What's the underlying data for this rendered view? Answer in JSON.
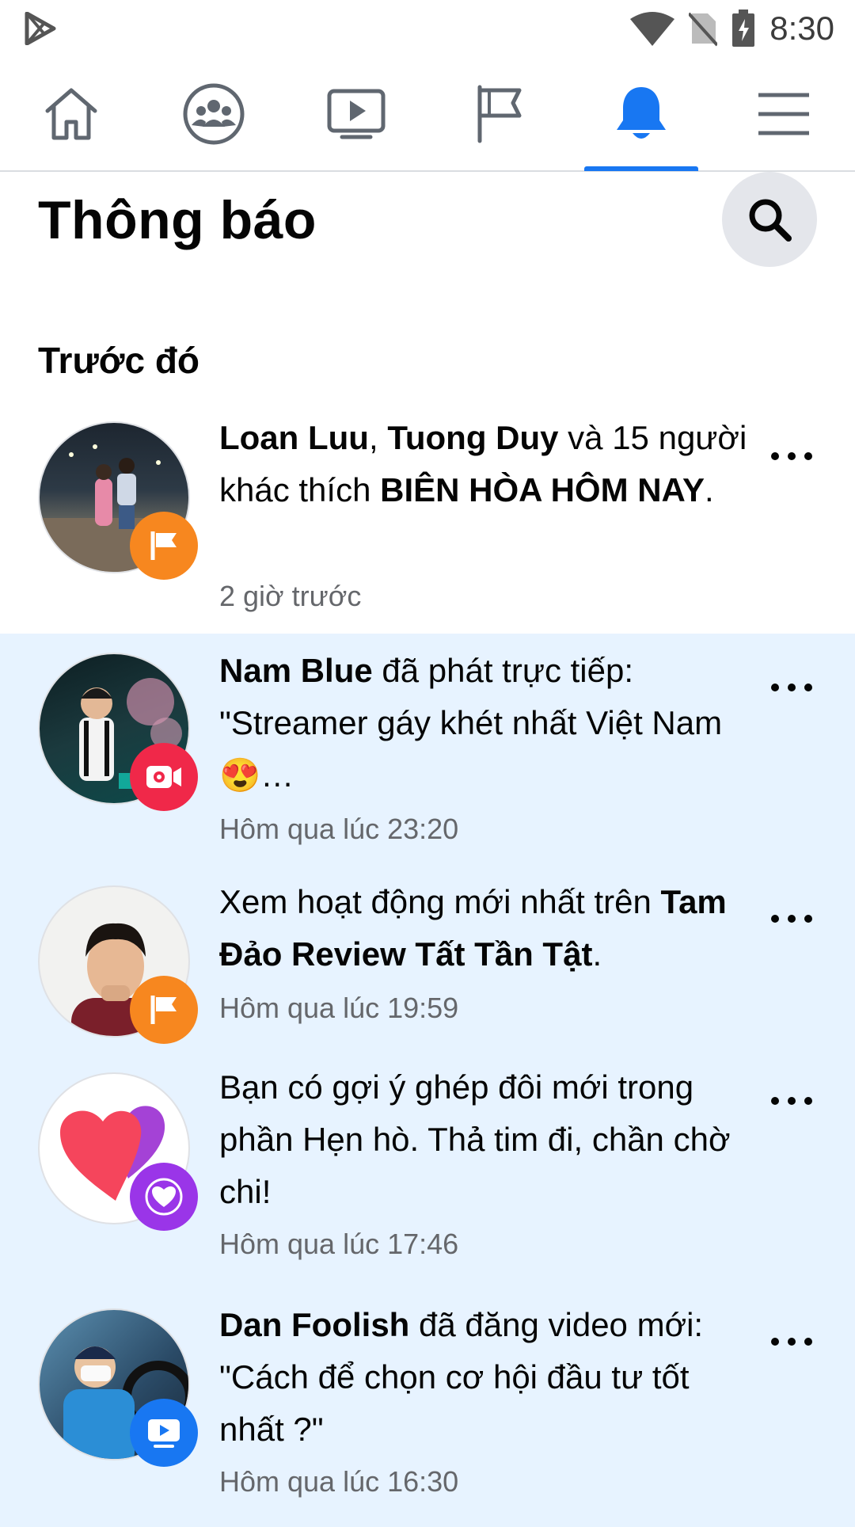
{
  "status_bar": {
    "time": "8:30",
    "icons": [
      "play-store-icon",
      "wifi-icon",
      "no-sim-icon",
      "battery-icon"
    ]
  },
  "nav": {
    "tabs": [
      {
        "name": "home",
        "icon": "home-icon"
      },
      {
        "name": "groups",
        "icon": "groups-icon"
      },
      {
        "name": "watch",
        "icon": "watch-icon"
      },
      {
        "name": "pages",
        "icon": "flag-icon"
      },
      {
        "name": "notifications",
        "icon": "bell-icon",
        "active": true
      },
      {
        "name": "menu",
        "icon": "menu-icon"
      }
    ],
    "accent": "#1877f2"
  },
  "header": {
    "title": "Thông báo"
  },
  "section": {
    "title": "Trước đó"
  },
  "notifications": [
    {
      "parts": [
        [
          "Loan Luu",
          true
        ],
        [
          ", ",
          false
        ],
        [
          "Tuong Duy",
          true
        ],
        [
          " và 15 người khác thích ",
          false
        ],
        [
          "BIÊN HÒA HÔM NAY",
          true
        ],
        [
          ".",
          false
        ]
      ],
      "time": "2 giờ trước",
      "badge": "flag-icon",
      "badge_color": "#f7871f",
      "unread": false
    },
    {
      "parts": [
        [
          "Nam Blue",
          true
        ],
        [
          " đã phát trực tiếp: \"Streamer gáy khét nhất Việt Nam 😍…",
          false
        ]
      ],
      "time": "Hôm qua lúc 23:20",
      "badge": "live-video-icon",
      "badge_color": "#f02849",
      "unread": true
    },
    {
      "parts": [
        [
          "Xem hoạt động mới nhất trên ",
          false
        ],
        [
          "Tam Đảo Review Tất Tần Tật",
          true
        ],
        [
          ".",
          false
        ]
      ],
      "time": "Hôm qua lúc 19:59",
      "badge": "flag-icon",
      "badge_color": "#f7871f",
      "unread": true
    },
    {
      "parts": [
        [
          "Bạn có gợi ý ghép đôi mới trong phần Hẹn hò. Thả tim đi, chần chờ chi!",
          false
        ]
      ],
      "time": "Hôm qua lúc 17:46",
      "badge": "dating-heart-icon",
      "badge_color": "#9a35e8",
      "unread": true
    },
    {
      "parts": [
        [
          "Dan Foolish",
          true
        ],
        [
          " đã đăng video mới: \"Cách để chọn cơ hội đầu tư tốt nhất ?\"",
          false
        ]
      ],
      "time": "Hôm qua lúc 16:30",
      "badge": "video-icon",
      "badge_color": "#1877f2",
      "unread": true
    }
  ]
}
